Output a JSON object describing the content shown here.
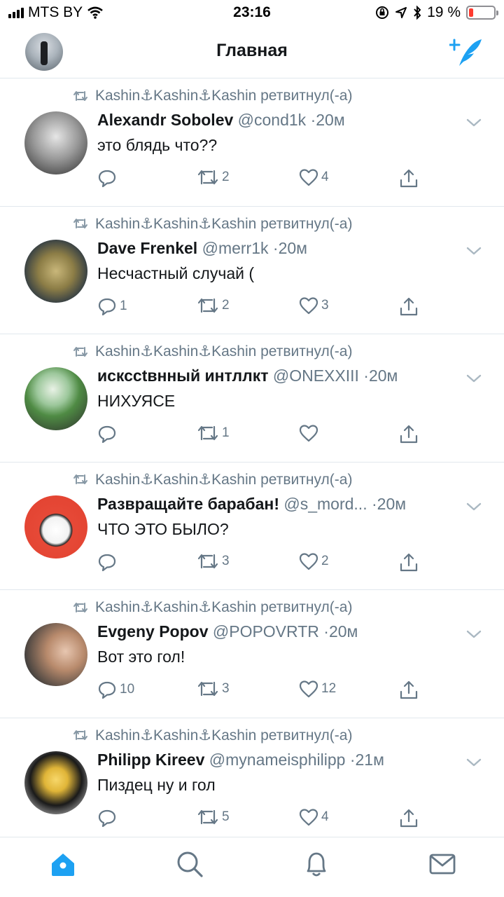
{
  "status_bar": {
    "carrier": "MTS BY",
    "time": "23:16",
    "battery_text": "19 %",
    "battery_level": 0.19
  },
  "nav": {
    "title": "Главная"
  },
  "retweet_label": "Kashin⚓Kashin⚓Kashin ретвитнул(-а)",
  "tweets": [
    {
      "name": "Alexandr Sobolev",
      "handle": "@cond1k",
      "time": "20м",
      "text": "это блядь что??",
      "replies": "",
      "retweets": "2",
      "likes": "4"
    },
    {
      "name": "Dave Frenkel",
      "handle": "@merr1k",
      "time": "20м",
      "text": "Несчастный случай (",
      "replies": "1",
      "retweets": "2",
      "likes": "3"
    },
    {
      "name": "искссtвнный интллкт",
      "handle": "@ONEXXIII",
      "time": "20м",
      "text": "НИХУЯСЕ",
      "replies": "",
      "retweets": "1",
      "likes": ""
    },
    {
      "name": "Развращайте барабан!",
      "handle": "@s_mord...",
      "time": "20м",
      "text": "ЧТО ЭТО БЫЛО?",
      "replies": "",
      "retweets": "3",
      "likes": "2"
    },
    {
      "name": "Evgeny Popov",
      "handle": "@POPOVRTR",
      "time": "20м",
      "text": "Вот это гол!",
      "replies": "10",
      "retweets": "3",
      "likes": "12"
    },
    {
      "name": "Philipp Kireev",
      "handle": "@mynameisphilipp",
      "time": "21м",
      "text": "Пиздец ну и гол",
      "replies": "",
      "retweets": "5",
      "likes": "4"
    }
  ],
  "tabs": [
    "home-icon",
    "search-icon",
    "notifications-icon",
    "messages-icon"
  ],
  "colors": {
    "accent": "#1da1f2",
    "muted": "#657786",
    "battery_low": "#ff3b30"
  }
}
